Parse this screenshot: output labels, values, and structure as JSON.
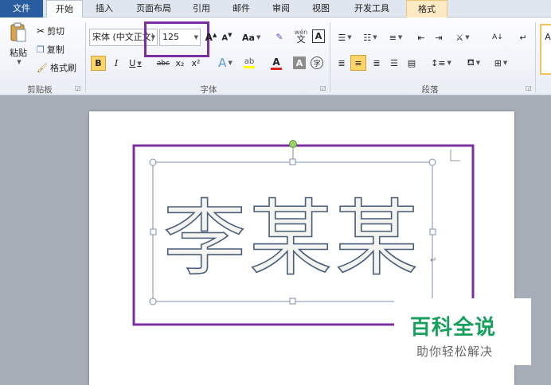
{
  "tabs": [
    {
      "label": "文件"
    },
    {
      "label": "开始"
    },
    {
      "label": "插入"
    },
    {
      "label": "页面布局"
    },
    {
      "label": "引用"
    },
    {
      "label": "邮件"
    },
    {
      "label": "审阅"
    },
    {
      "label": "视图"
    },
    {
      "label": "开发工具"
    },
    {
      "label": "格式"
    }
  ],
  "clipboard": {
    "paste": "粘贴",
    "cut": "剪切",
    "copy": "复制",
    "format_painter": "格式刷",
    "group": "剪贴板"
  },
  "font": {
    "name": "宋体 (中文正文)",
    "size": "125",
    "group": "字体",
    "aa_label": "Aa",
    "pinyin": "wén",
    "char_box": "A",
    "highlight_color": "#ffff00",
    "font_color": "#e0201b"
  },
  "paragraph": {
    "group": "段落"
  },
  "styles": {
    "peek": "A"
  },
  "document": {
    "text": "李某某",
    "text_fill": "#f3f4ef",
    "text_stroke": "#4a5e7a",
    "highlight_color": "#7b2fa3"
  },
  "watermark": {
    "title": "百科全说",
    "subtitle": "助你轻松解决",
    "title_color": "#17a05d"
  }
}
